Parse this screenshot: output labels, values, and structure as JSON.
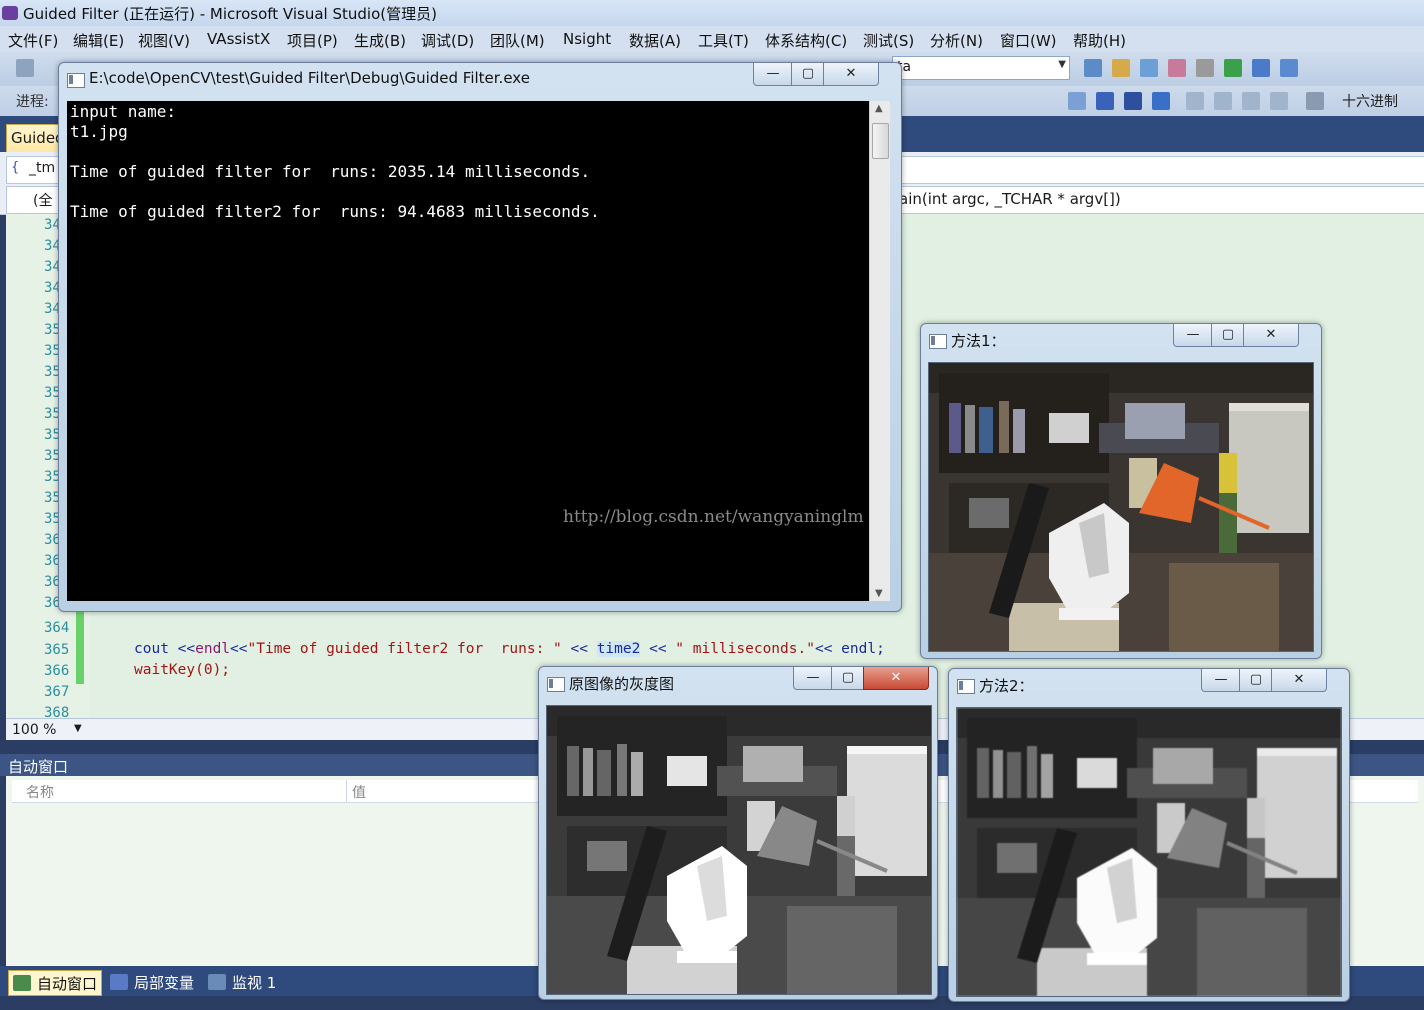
{
  "vs": {
    "title": "Guided Filter (正在运行) - Microsoft Visual Studio(管理员)",
    "menu": [
      "文件(F)",
      "编辑(E)",
      "视图(V)",
      "VAssistX",
      "项目(P)",
      "生成(B)",
      "调试(D)",
      "团队(M)",
      "Nsight",
      "数据(A)",
      "工具(T)",
      "体系结构(C)",
      "测试(S)",
      "分析(N)",
      "窗口(W)",
      "帮助(H)"
    ],
    "toolbar": {
      "progress_label": "进程:",
      "config_combo": "ta",
      "hex_label": "十六进制"
    },
    "doc_tab": "Guided",
    "nav": {
      "scope_left": "_tm",
      "scope_all": "(全",
      "function": "ain(int argc, _TCHAR * argv[])"
    },
    "editor": {
      "line_numbers": [
        "34",
        "34",
        "34",
        "34",
        "34",
        "35",
        "35",
        "35",
        "35",
        "35",
        "35",
        "35",
        "35",
        "35",
        "35",
        "36",
        "36",
        "36",
        "36",
        "364",
        "365",
        "366",
        "367",
        "368"
      ],
      "code": {
        "l365_a": "cout <<",
        "l365_b": "endl",
        "l365_c": "<<",
        "l365_d": "\"Time of guided filter2 for  runs: \"",
        "l365_e": " << ",
        "l365_f": "time2",
        "l365_g": " << ",
        "l365_h": "\" milliseconds.\"",
        "l365_i": "<< endl;",
        "l366": "waitKey(0);"
      }
    },
    "zoom": "100 %",
    "autos": {
      "title": "自动窗口",
      "col_name": "名称",
      "col_value": "值"
    },
    "bottom_tabs": [
      "自动窗口",
      "局部变量",
      "监视 1"
    ]
  },
  "console": {
    "title": "E:\\code\\OpenCV\\test\\Guided Filter\\Debug\\Guided Filter.exe",
    "lines": [
      "input name:",
      "t1.jpg",
      "",
      "Time of guided filter for  runs: 2035.14 milliseconds.",
      "",
      "Time of guided filter2 for  runs: 94.4683 milliseconds."
    ],
    "watermark": "http://blog.csdn.net/wangyaninglm"
  },
  "windows": {
    "method1": "方法1：",
    "gray": "原图像的灰度图",
    "method2": "方法2："
  },
  "icons": {
    "minimize": "—",
    "maximize": "▢",
    "close": "✕",
    "scroll_up": "▲",
    "scroll_down": "▼",
    "dropdown": "▼"
  },
  "colors": {
    "accent_tab": "#ffe7a3",
    "editor_bg": "#e1f0e2",
    "change_bar": "#6ad06a",
    "close_red": "#c74a33"
  }
}
